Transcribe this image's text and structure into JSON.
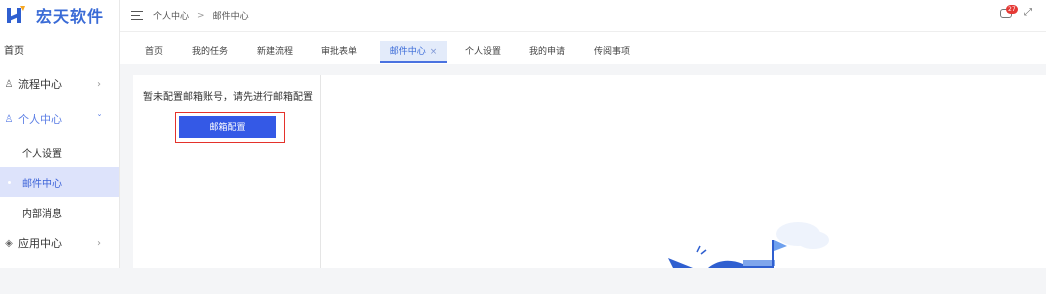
{
  "app": {
    "logo_text": "宏天软件"
  },
  "breadcrumb": {
    "items": [
      "个人中心",
      "邮件中心"
    ],
    "separator": ">"
  },
  "header": {
    "notification_count": "27"
  },
  "sidebar": {
    "home": "首页",
    "items": [
      {
        "label": "流程中心",
        "icon": "flow-icon"
      },
      {
        "label": "个人中心",
        "icon": "person-icon",
        "open": true
      },
      {
        "label": "个人设置",
        "sub": true
      },
      {
        "label": "邮件中心",
        "sub": true,
        "active": true
      },
      {
        "label": "内部消息",
        "sub": true
      },
      {
        "label": "应用中心",
        "icon": "app-icon"
      }
    ]
  },
  "tabs": [
    {
      "label": "首页"
    },
    {
      "label": "我的任务"
    },
    {
      "label": "新建流程"
    },
    {
      "label": "审批表单"
    },
    {
      "label": "邮件中心",
      "active": true,
      "close": "×"
    },
    {
      "label": "个人设置"
    },
    {
      "label": "我的申请"
    },
    {
      "label": "传阅事项"
    }
  ],
  "main": {
    "notice": "暂未配置邮箱账号，请先进行邮箱配置",
    "config_button": "邮箱配置"
  },
  "colors": {
    "accent": "#3459e6",
    "highlight": "#e4322b",
    "brand": "#3a6bd6"
  }
}
